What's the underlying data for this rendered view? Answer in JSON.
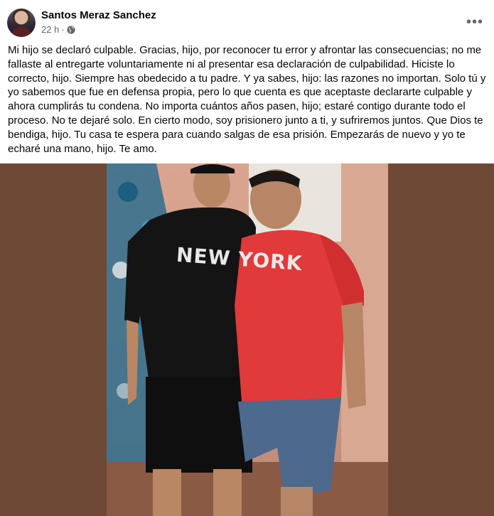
{
  "post": {
    "author": "Santos Meraz Sanchez",
    "time": "22 h",
    "separator": "·",
    "privacy_icon": "globe-icon",
    "more_icon": "more-options-icon",
    "paragraphs": [
      "Mi hijo se declaró culpable. Gracias, hijo, por reconocer tu error y afrontar las consecuencias; no me fallaste al entregarte voluntariamente ni al presentar esa declaración de culpabilidad. Hiciste lo correcto, hijo. Siempre has obedecido a tu padre. Y ya sabes, hijo: las razones no importan. Solo tú y yo sabemos que fue en defensa propia, pero lo que cuenta es que aceptaste declararte culpable y ahora cumplirás tu condena. No importa cuántos años pasen, hijo; estaré contigo durante todo el proceso. No te dejaré solo. En cierto modo, soy prisionero junto a ti, y sufriremos juntos. Que Dios te bendiga, hijo. Tu casa te espera para cuando salgas de esa prisión. Empezarás de nuevo y yo te echaré una mano, hijo. Te amo."
    ],
    "photo": {
      "shirt_text": "NEW YORK"
    }
  },
  "colors": {
    "text": "#050505",
    "secondary": "#65676b",
    "photo_backdrop": "#6e4936",
    "red_shirt": "#e03a3a",
    "black_shirt": "#141414"
  }
}
